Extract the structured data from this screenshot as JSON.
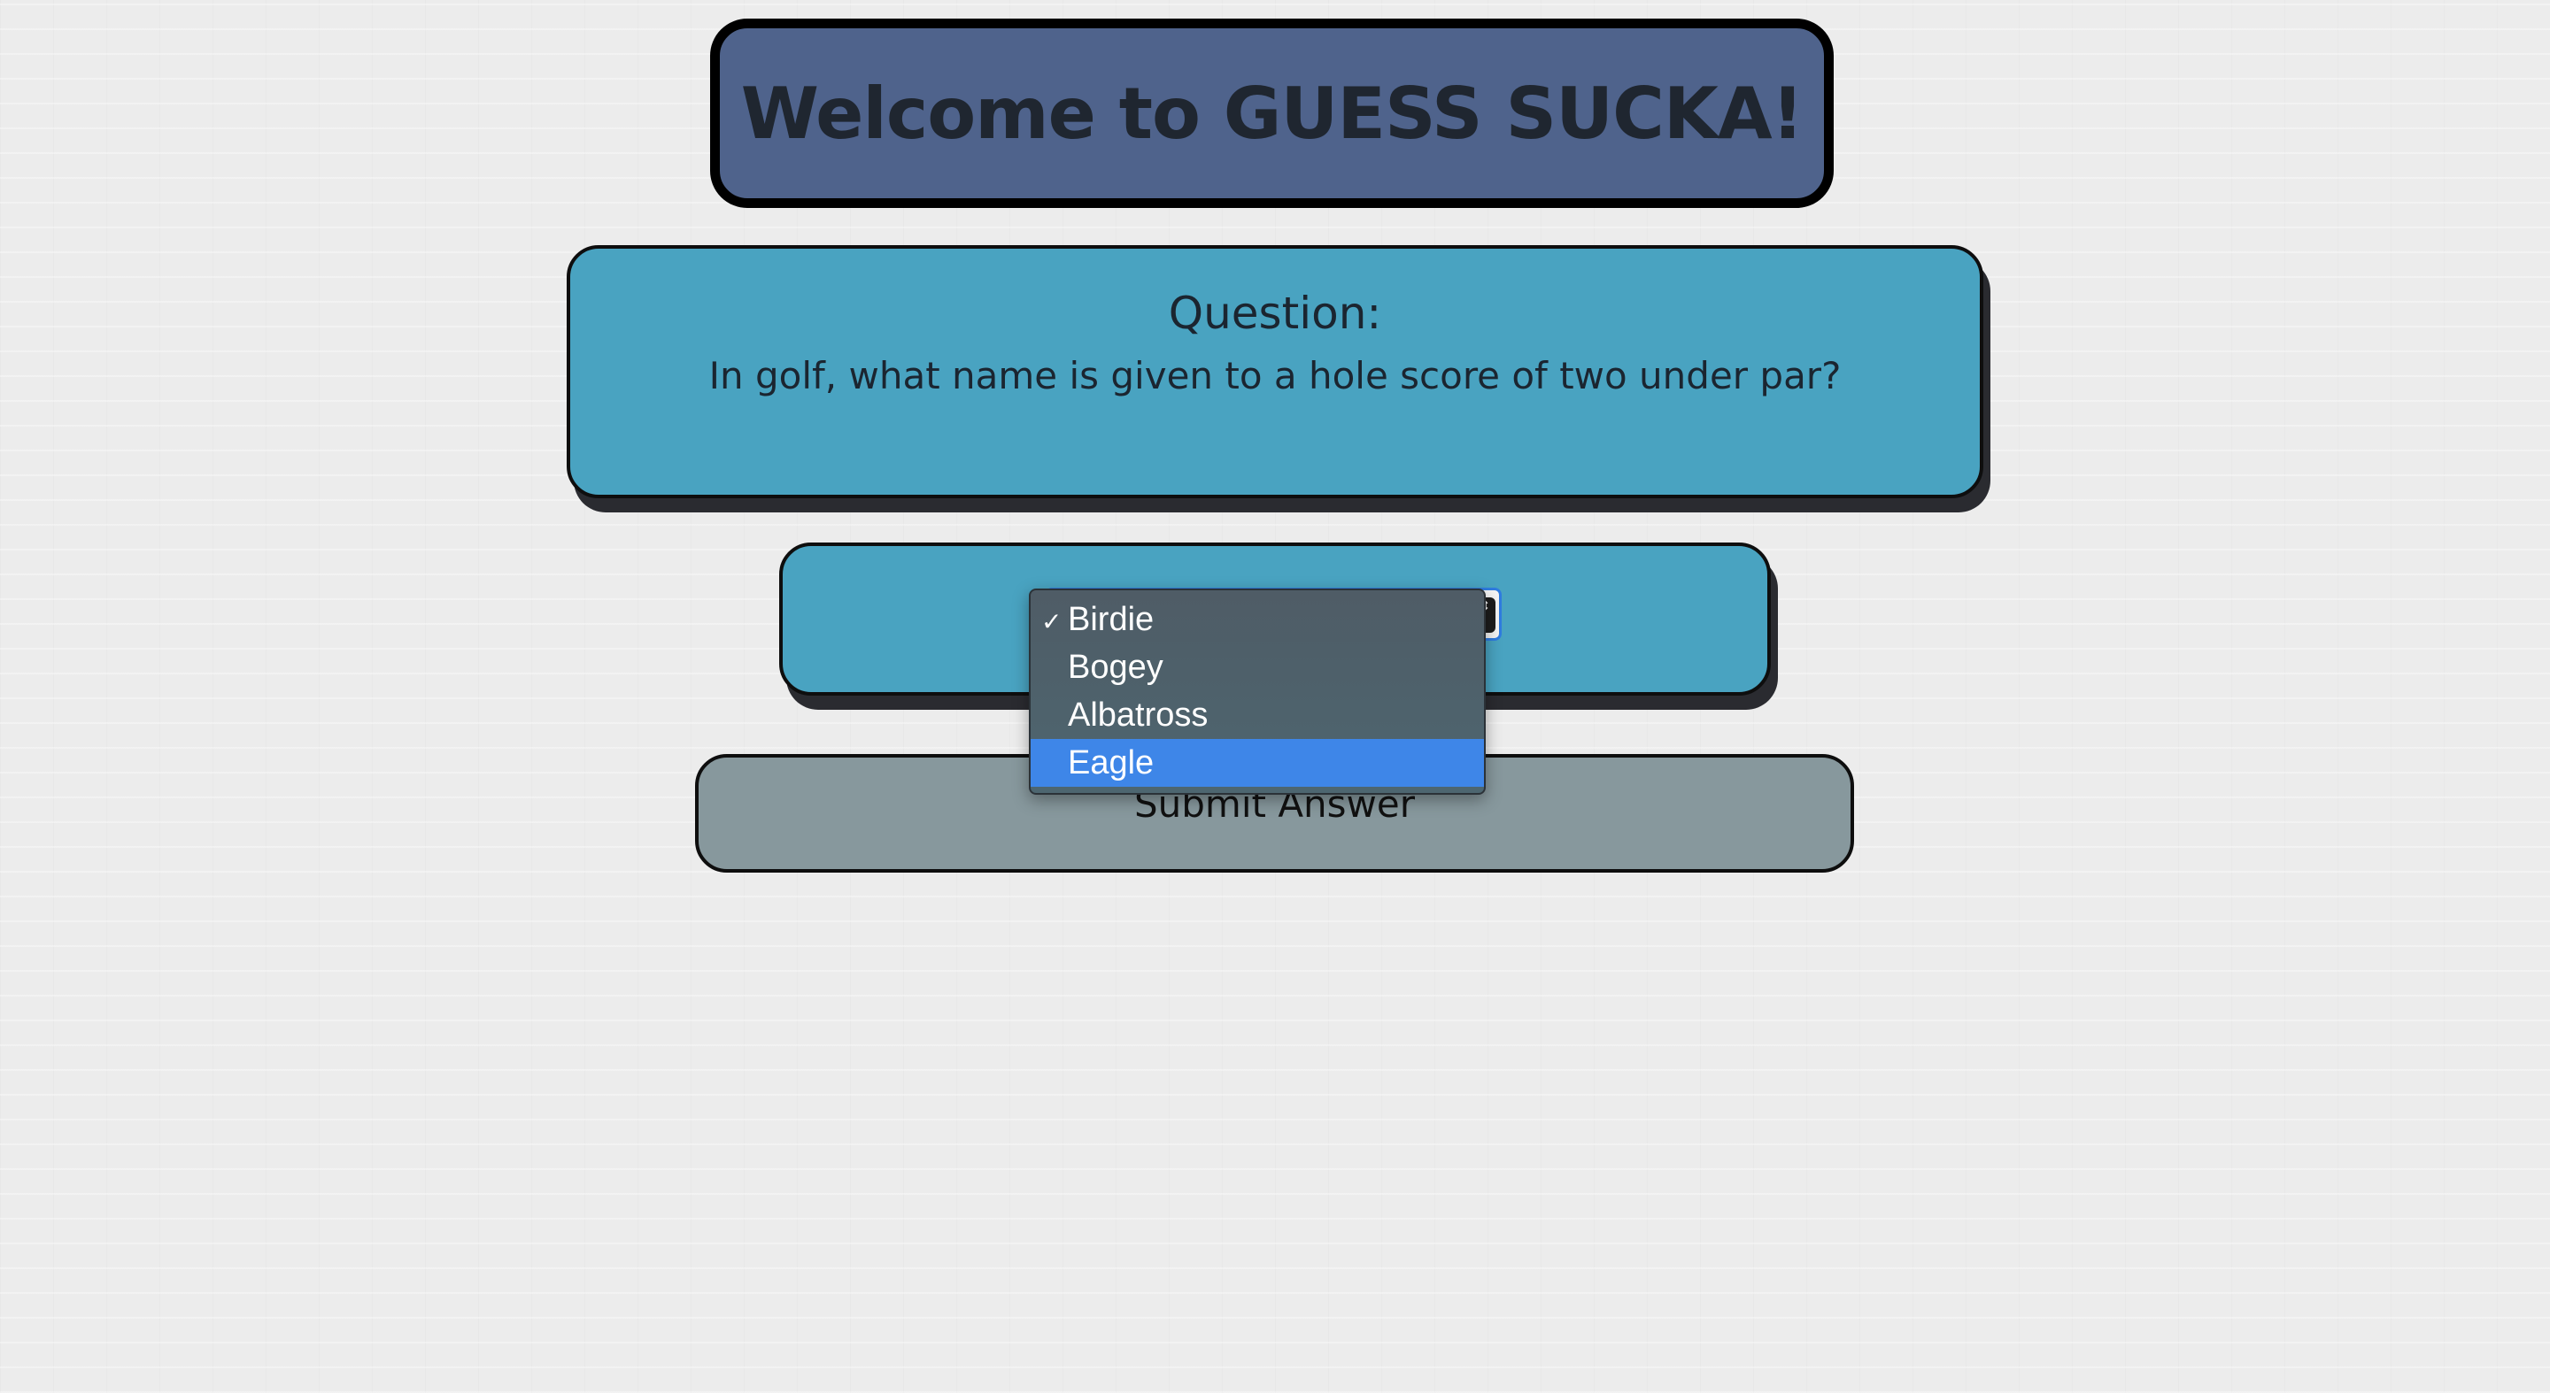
{
  "header": {
    "title": "Welcome to GUESS SUCKA!"
  },
  "question": {
    "heading": "Question:",
    "text": "In golf, what name is given to a hole score of two under par?"
  },
  "answer": {
    "selected": "Birdie",
    "options": [
      {
        "label": "Birdie",
        "checked": true,
        "highlighted": false
      },
      {
        "label": "Bogey",
        "checked": false,
        "highlighted": false
      },
      {
        "label": "Albatross",
        "checked": false,
        "highlighted": false
      },
      {
        "label": "Eagle",
        "checked": false,
        "highlighted": true
      }
    ],
    "check_glyph": "✓",
    "arrows_glyph": "⇕"
  },
  "submit": {
    "label": "Submit Answer"
  },
  "colors": {
    "page_background": "#ececec",
    "title_box": "#4f638c",
    "question_box": "#49a3c1",
    "submit_button": "#87989d",
    "dropdown_background": "#4f5c66",
    "dropdown_highlight": "#3e86e8"
  }
}
